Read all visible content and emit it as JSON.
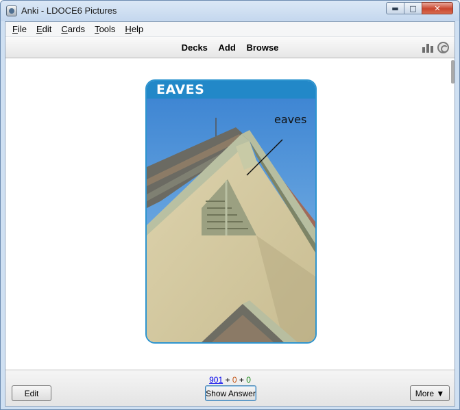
{
  "window": {
    "title": "Anki - LDOCE6 Pictures",
    "controls": {
      "minimize": "▬",
      "maximize": "□",
      "close": "✕"
    }
  },
  "menu": {
    "items": [
      {
        "accel": "F",
        "rest": "ile"
      },
      {
        "accel": "E",
        "rest": "dit"
      },
      {
        "accel": "C",
        "rest": "ards"
      },
      {
        "accel": "T",
        "rest": "ools"
      },
      {
        "accel": "H",
        "rest": "elp"
      }
    ]
  },
  "toolbar": {
    "links": [
      "Decks",
      "Add",
      "Browse"
    ],
    "icons": [
      "stats-icon",
      "sync-icon"
    ]
  },
  "card": {
    "title": "EAVES",
    "picture_label": "eaves",
    "header_color": "#2288c8",
    "border_color": "#2d94cf"
  },
  "bottom": {
    "counts": {
      "new": "901",
      "plus1": "+",
      "learn": "0",
      "plus2": "+",
      "review": "0"
    },
    "edit_label": "Edit",
    "show_answer_label": "Show Answer",
    "more_label": "More ▼"
  }
}
